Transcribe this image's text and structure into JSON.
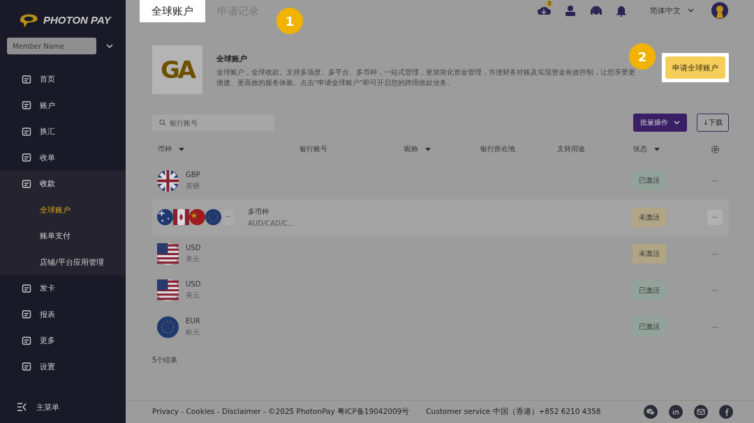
{
  "sidebar": {
    "logo": "PHOTON PAY",
    "member": {
      "placeholder": "Member Name"
    },
    "items": [
      {
        "label": "首页",
        "expanded": false
      },
      {
        "label": "账户",
        "expanded": false
      },
      {
        "label": "换汇",
        "expanded": false
      },
      {
        "label": "收单",
        "expanded": false
      },
      {
        "label": "收款",
        "expanded": true,
        "children": [
          {
            "label": "全球账户",
            "selected": true
          },
          {
            "label": "账单支付",
            "selected": false
          },
          {
            "label": "店铺/平台应用管理",
            "selected": false
          }
        ]
      },
      {
        "label": "发卡",
        "expanded": false
      },
      {
        "label": "报表",
        "expanded": false
      },
      {
        "label": "更多",
        "expanded": false
      },
      {
        "label": "设置",
        "expanded": false
      }
    ],
    "main_menu": "主菜单"
  },
  "tabs": [
    {
      "label": "全球账户",
      "selected": true
    },
    {
      "label": "申请记录",
      "selected": false
    }
  ],
  "header": {
    "download_badge": "3",
    "language": "简体中文"
  },
  "callouts": [
    "1",
    "2"
  ],
  "intro": {
    "logo": "GA",
    "title": "全球账户",
    "text": "全球账户，全球收款。支持多场景、多平台、多币种，一站式管理，更加简化资金管理，方便财务对账及实现资金有效控制，让您享受更便捷、更高效的服务体验。点击“申请全球账户”即可开启您的跨境收款业务。",
    "button": "申请全球账户"
  },
  "toolbar": {
    "search": {
      "placeholder": "银行账号"
    },
    "batch": "批量操作",
    "download": "↓下载"
  },
  "table": {
    "columns": [
      {
        "label": "币种",
        "sortable": true
      },
      {
        "label": "银行账号",
        "sortable": false
      },
      {
        "label": "昵称",
        "sortable": true
      },
      {
        "label": "银行所在地",
        "sortable": false
      },
      {
        "label": "支持用途",
        "sortable": false
      },
      {
        "label": "状态",
        "sortable": true
      }
    ],
    "rows": [
      {
        "code": "GBP",
        "name": "英镑",
        "status": "已激活",
        "active": true,
        "selected": false
      },
      {
        "code": "多币种",
        "name": "AUD/CAD/C...",
        "status": "未激活",
        "active": false,
        "selected": true
      },
      {
        "code": "USD",
        "name": "美元",
        "status": "未激活",
        "active": false,
        "selected": false
      },
      {
        "code": "USD",
        "name": "美元",
        "status": "已激活",
        "active": true,
        "selected": false
      },
      {
        "code": "EUR",
        "name": "欧元",
        "status": "已激活",
        "active": true,
        "selected": false
      }
    ],
    "more": "···",
    "result_count": "5个结果"
  },
  "footer": {
    "links": "Privacy - Cookies - Disclaimer - ©2025 PhotonPay 粤ICP备19042009号",
    "service": "Customer service 中国（香港）+852 6210 4358"
  }
}
